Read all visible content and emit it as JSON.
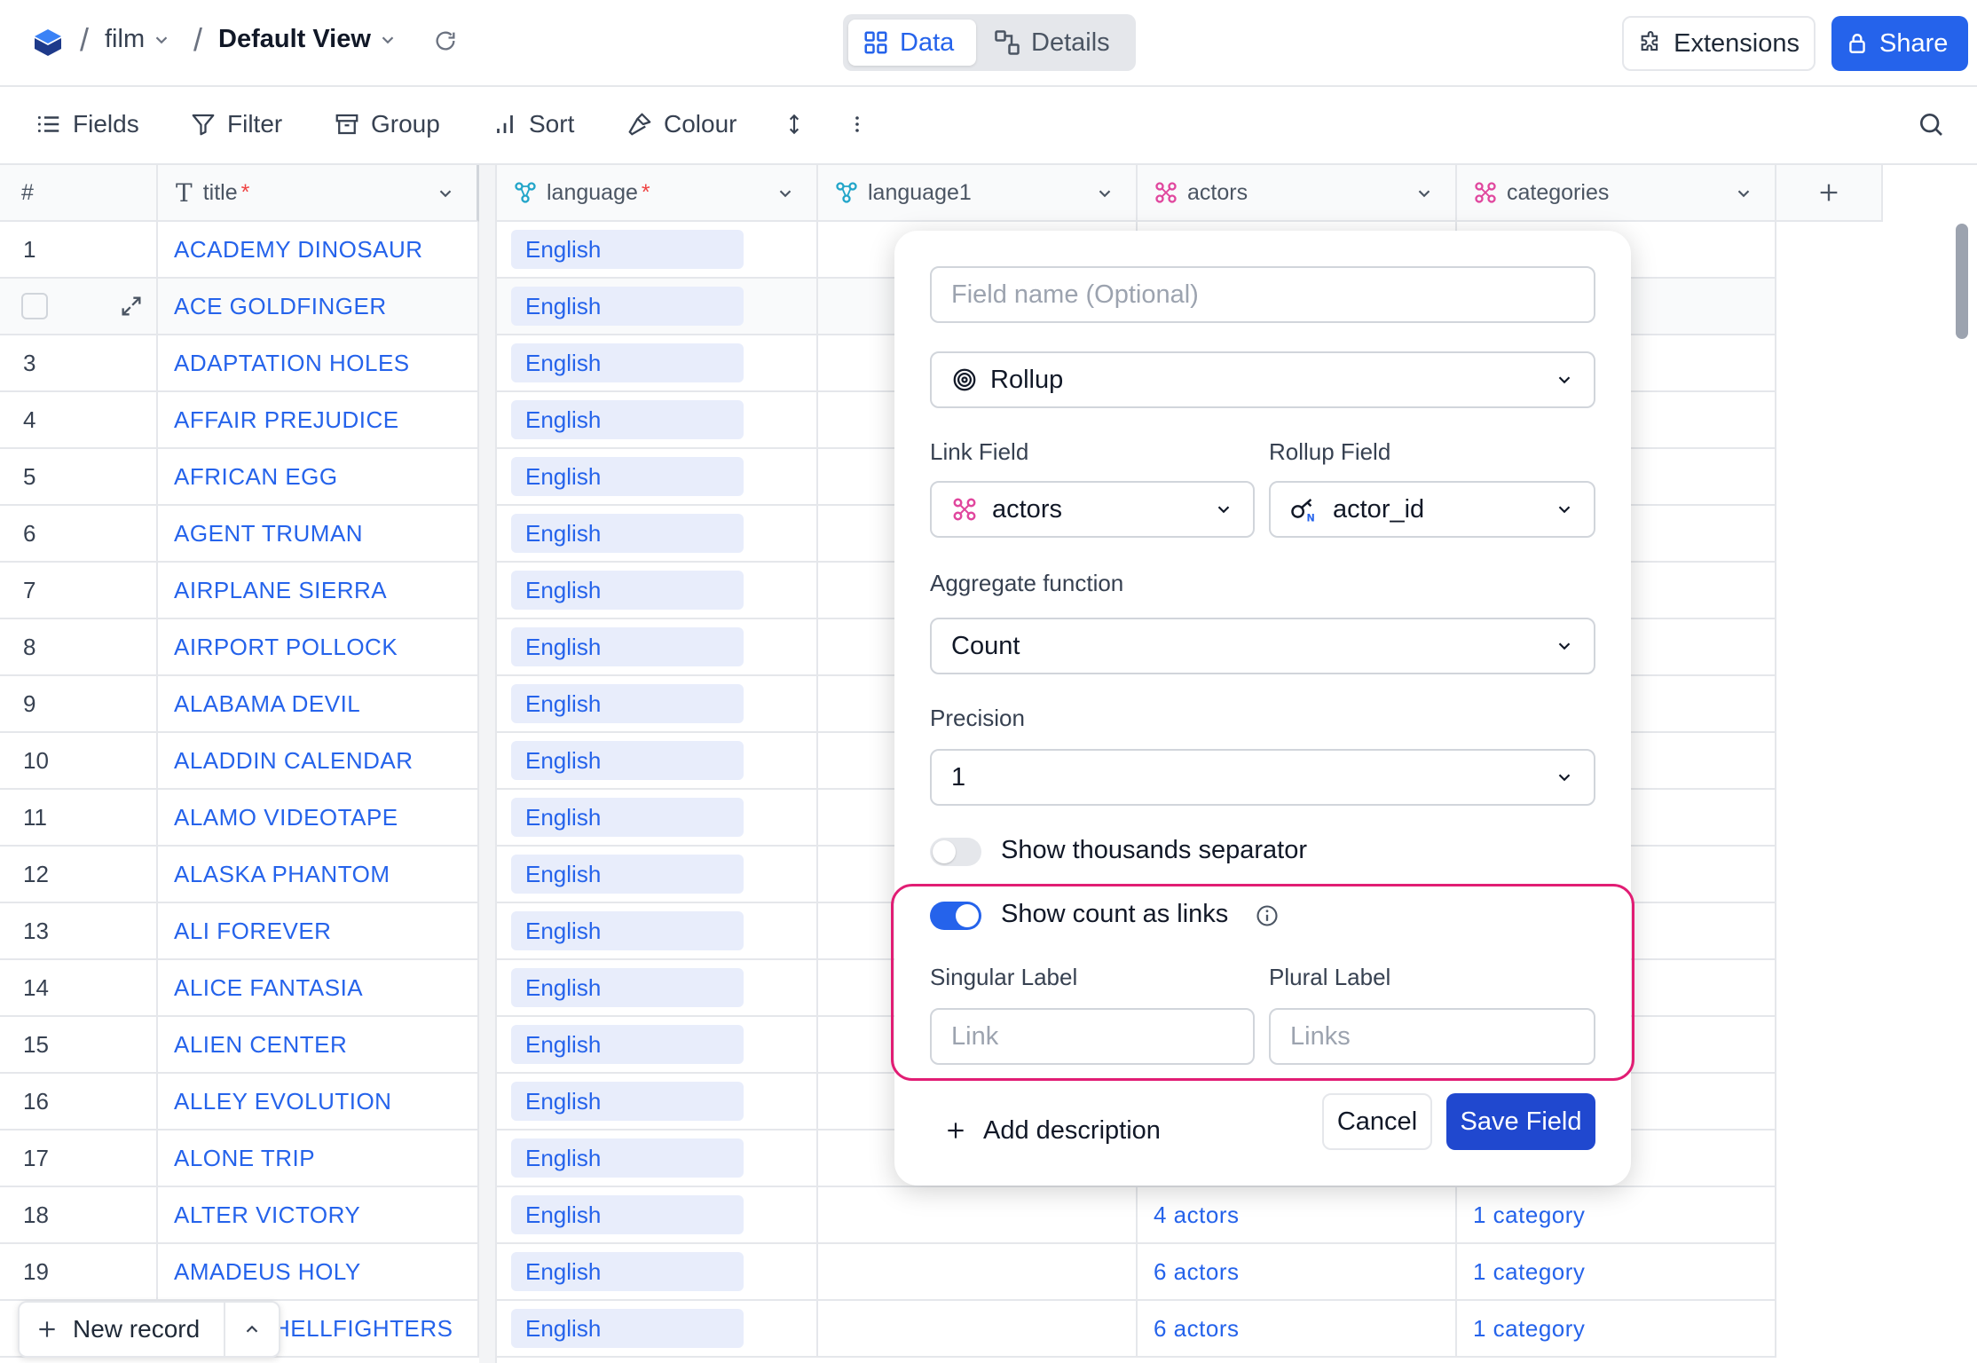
{
  "topbar": {
    "table_name": "film",
    "view_name": "Default View",
    "tabs": [
      {
        "label": "Data"
      },
      {
        "label": "Details"
      }
    ],
    "extensions_label": "Extensions",
    "share_label": "Share"
  },
  "toolbar": {
    "fields": "Fields",
    "filter": "Filter",
    "group": "Group",
    "sort": "Sort",
    "colour": "Colour"
  },
  "columns": {
    "rownum": "#",
    "title": "title",
    "language": "language",
    "language1": "language1",
    "actors": "actors",
    "categories": "categories",
    "required_mark": "*"
  },
  "rows": [
    {
      "num": "1",
      "title": "ACADEMY DINOSAUR",
      "language": "English",
      "actors": "",
      "categories": ""
    },
    {
      "num": "",
      "title": "ACE GOLDFINGER",
      "language": "English",
      "actors": "",
      "categories": ""
    },
    {
      "num": "3",
      "title": "ADAPTATION HOLES",
      "language": "English",
      "actors": "",
      "categories": ""
    },
    {
      "num": "4",
      "title": "AFFAIR PREJUDICE",
      "language": "English",
      "actors": "",
      "categories": ""
    },
    {
      "num": "5",
      "title": "AFRICAN EGG",
      "language": "English",
      "actors": "",
      "categories": ""
    },
    {
      "num": "6",
      "title": "AGENT TRUMAN",
      "language": "English",
      "actors": "",
      "categories": ""
    },
    {
      "num": "7",
      "title": "AIRPLANE SIERRA",
      "language": "English",
      "actors": "",
      "categories": ""
    },
    {
      "num": "8",
      "title": "AIRPORT POLLOCK",
      "language": "English",
      "actors": "",
      "categories": ""
    },
    {
      "num": "9",
      "title": "ALABAMA DEVIL",
      "language": "English",
      "actors": "",
      "categories": ""
    },
    {
      "num": "10",
      "title": "ALADDIN CALENDAR",
      "language": "English",
      "actors": "",
      "categories": ""
    },
    {
      "num": "11",
      "title": "ALAMO VIDEOTAPE",
      "language": "English",
      "actors": "",
      "categories": ""
    },
    {
      "num": "12",
      "title": "ALASKA PHANTOM",
      "language": "English",
      "actors": "",
      "categories": ""
    },
    {
      "num": "13",
      "title": "ALI FOREVER",
      "language": "English",
      "actors": "",
      "categories": ""
    },
    {
      "num": "14",
      "title": "ALICE FANTASIA",
      "language": "English",
      "actors": "",
      "categories": ""
    },
    {
      "num": "15",
      "title": "ALIEN CENTER",
      "language": "English",
      "actors": "",
      "categories": ""
    },
    {
      "num": "16",
      "title": "ALLEY EVOLUTION",
      "language": "English",
      "actors": "",
      "categories": ""
    },
    {
      "num": "17",
      "title": "ALONE TRIP",
      "language": "English",
      "actors": "",
      "categories": ""
    },
    {
      "num": "18",
      "title": "ALTER VICTORY",
      "language": "English",
      "actors": "4 actors",
      "categories": "1 category"
    },
    {
      "num": "19",
      "title": "AMADEUS HOLY",
      "language": "English",
      "actors": "6 actors",
      "categories": "1 category"
    },
    {
      "num": "",
      "title": "HELLFIGHTERS",
      "language": "English",
      "actors": "6 actors",
      "categories": "1 category"
    }
  ],
  "footer": {
    "new_record": "New record"
  },
  "popup": {
    "field_name_placeholder": "Field name (Optional)",
    "field_type": "Rollup",
    "link_field_label": "Link Field",
    "link_field_value": "actors",
    "rollup_field_label": "Rollup Field",
    "rollup_field_value": "actor_id",
    "aggregate_label": "Aggregate function",
    "aggregate_value": "Count",
    "precision_label": "Precision",
    "precision_value": "1",
    "thousands_label": "Show thousands separator",
    "thousands_on": false,
    "count_links_label": "Show count as links",
    "count_links_on": true,
    "singular_label": "Singular Label",
    "singular_placeholder": "Link",
    "plural_label": "Plural Label",
    "plural_placeholder": "Links",
    "add_description": "Add description",
    "cancel": "Cancel",
    "save": "Save Field"
  },
  "colors": {
    "accent": "#2563eb",
    "chip_bg": "#e8edfb",
    "highlight_border": "#e11d74",
    "link_icon": "#e0479e",
    "language_icon": "#22a5c9"
  }
}
